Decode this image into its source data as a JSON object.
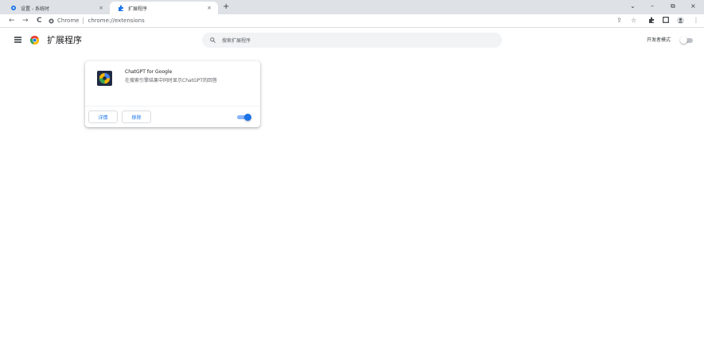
{
  "browser": {
    "tabs": [
      {
        "title": "设置 - 系统时",
        "icon": "gear-icon",
        "icon_color": "#1a73e8"
      },
      {
        "title": "扩展程序",
        "icon": "puzzle-icon",
        "icon_color": "#1a73e8"
      }
    ],
    "new_tab_label": "+",
    "window_controls": {
      "minimize": "–",
      "restore": "⧉",
      "close": "×",
      "tab_search": "⌄"
    },
    "omnibox": {
      "chip": "Chrome",
      "url": "chrome://extensions"
    },
    "nav": {
      "back": "←",
      "forward": "→",
      "reload": "C"
    }
  },
  "extensions_page": {
    "title": "扩展程序",
    "search_placeholder": "搜索扩展程序",
    "developer_mode": {
      "label": "开发者模式",
      "enabled": false
    }
  },
  "extensions": [
    {
      "name": "ChatGPT for Google",
      "description": "在搜索引擎结果中同时显示ChatGPT的回答",
      "details_label": "详情",
      "remove_label": "移除",
      "enabled": true
    }
  ],
  "colors": {
    "accent": "#1a73e8",
    "toggle_on_track": "#8ab4f8",
    "tabstrip": "#dee1e6"
  }
}
